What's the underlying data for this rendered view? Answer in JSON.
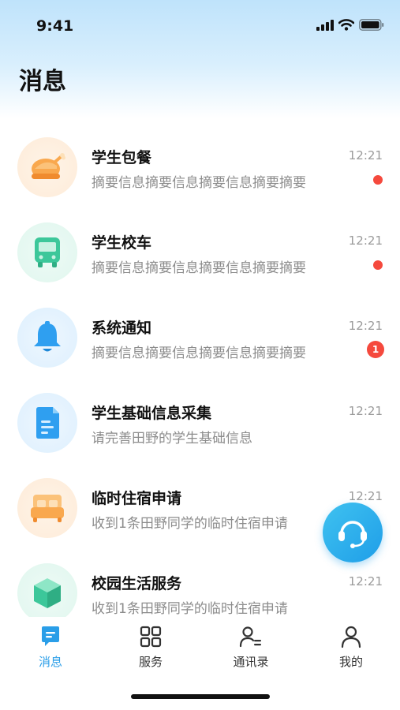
{
  "status_bar": {
    "time": "9:41"
  },
  "header": {
    "title": "消息"
  },
  "messages": [
    {
      "name": "学生包餐",
      "summary": "摘要信息摘要信息摘要信息摘要摘要",
      "time": "12:21",
      "unread": "dot",
      "icon": "roast-chicken-icon",
      "accent": "#f7a64a"
    },
    {
      "name": "学生校车",
      "summary": "摘要信息摘要信息摘要信息摘要摘要",
      "time": "12:21",
      "unread": "dot",
      "icon": "bus-icon",
      "accent": "#3cc79a"
    },
    {
      "name": "系统通知",
      "summary": "摘要信息摘要信息摘要信息摘要摘要",
      "time": "12:21",
      "unread": "1",
      "icon": "bell-icon",
      "accent": "#2f9ff0"
    },
    {
      "name": "学生基础信息采集",
      "summary": "请完善田野的学生基础信息",
      "time": "12:21",
      "unread": "",
      "icon": "document-icon",
      "accent": "#2f9ff0"
    },
    {
      "name": "临时住宿申请",
      "summary": "收到1条田野同学的临时住宿申请",
      "time": "12:21",
      "unread": "",
      "icon": "bed-icon",
      "accent": "#f7a64a"
    },
    {
      "name": "校园生活服务",
      "summary": "收到1条田野同学的临时住宿申请",
      "time": "12:21",
      "unread": "",
      "icon": "cube-icon",
      "accent": "#3cc79a"
    }
  ],
  "fab": {
    "icon": "customer-service-icon"
  },
  "tabbar": {
    "tabs": [
      {
        "label": "消息",
        "icon": "message-icon",
        "active": true
      },
      {
        "label": "服务",
        "icon": "grid-icon",
        "active": false
      },
      {
        "label": "通讯录",
        "icon": "contacts-icon",
        "active": false
      },
      {
        "label": "我的",
        "icon": "profile-icon",
        "active": false
      }
    ],
    "active_color": "#2a9ee8"
  }
}
